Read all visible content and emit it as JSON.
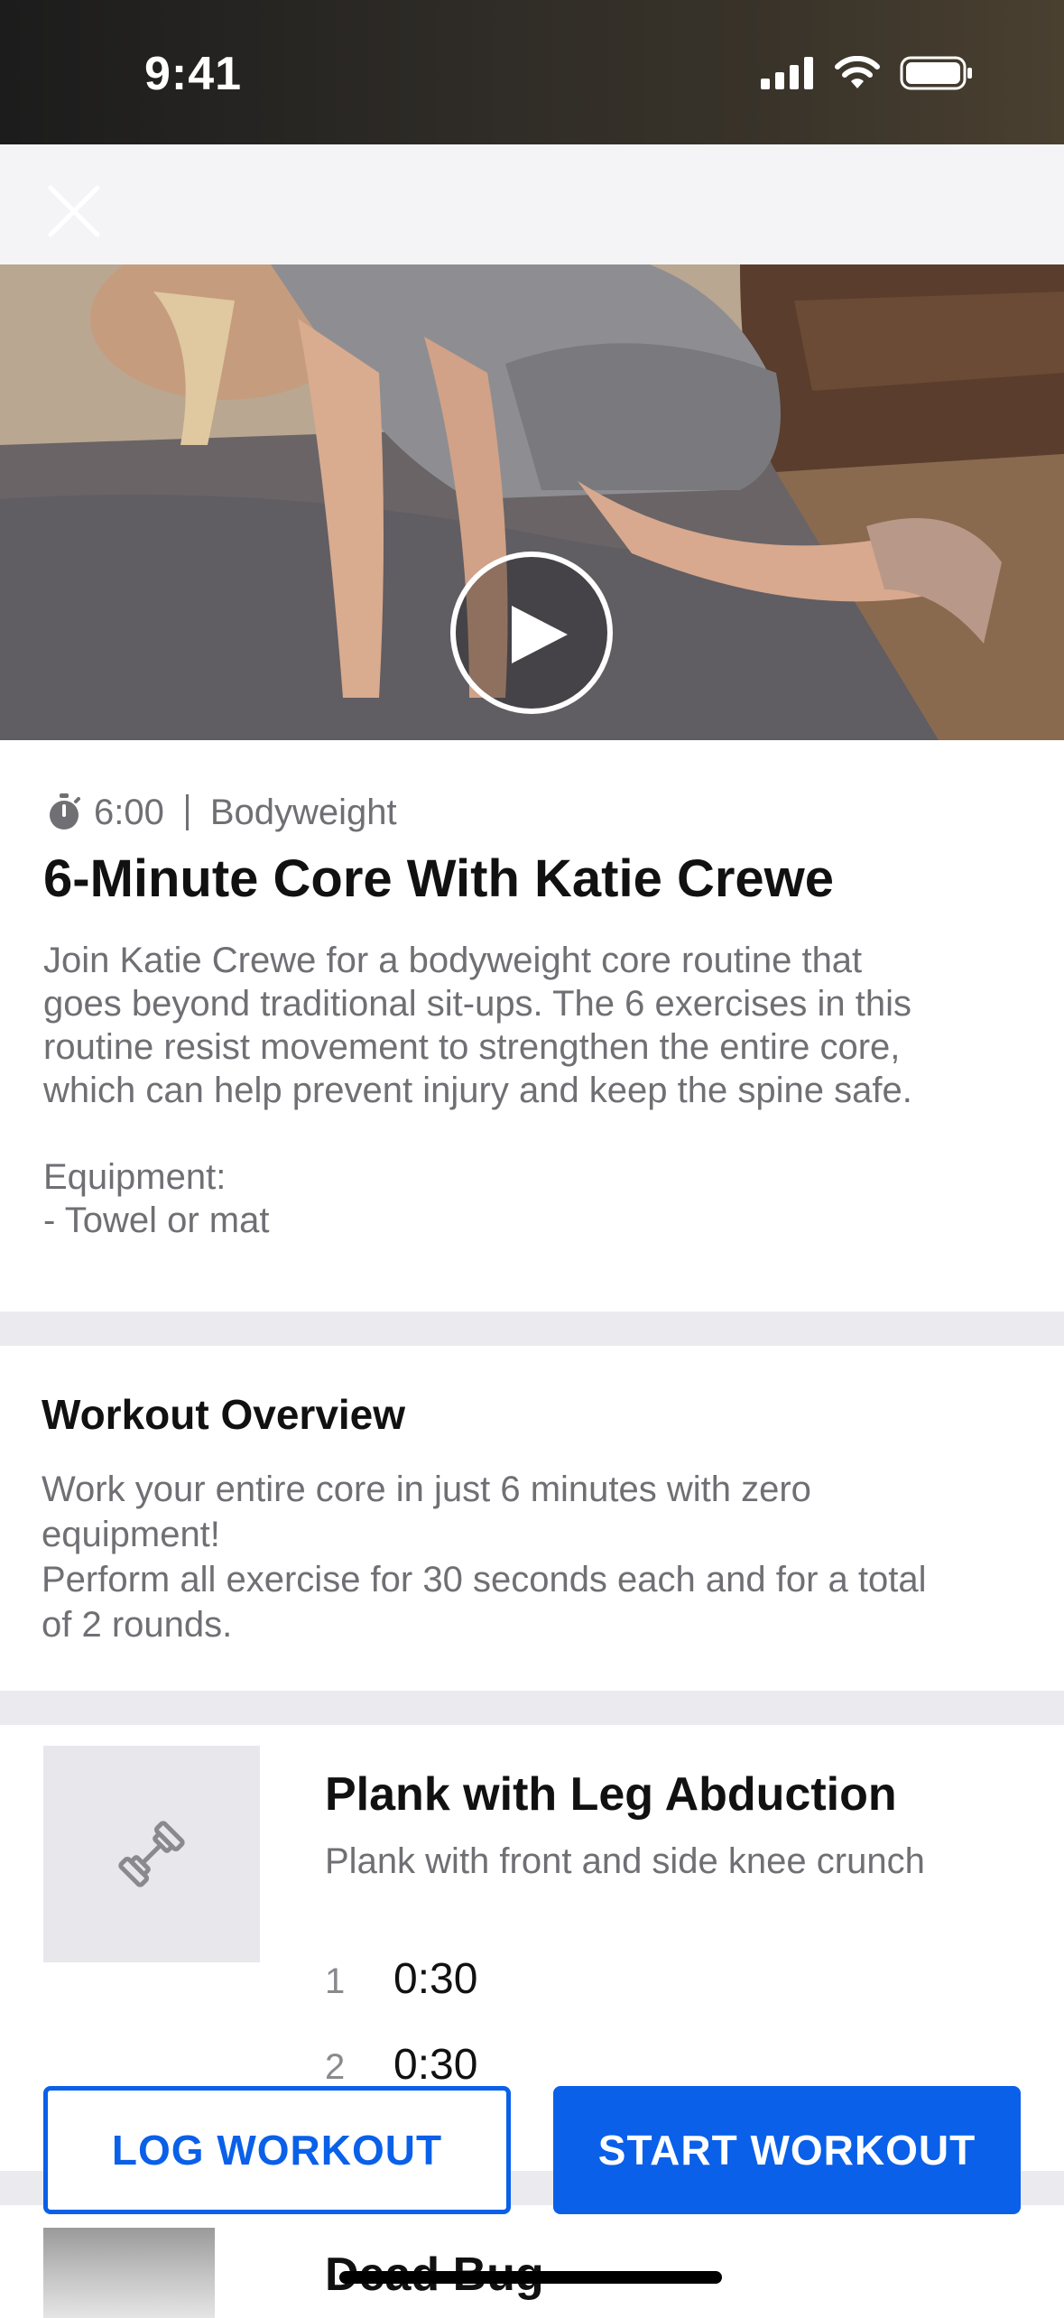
{
  "status_bar": {
    "time": "9:41"
  },
  "workout": {
    "duration": "6:00",
    "category": "Bodyweight",
    "title": "6-Minute Core With Katie Crewe",
    "description": "Join Katie Crewe for a bodyweight core routine that\ngoes beyond traditional sit-ups. The 6 exercises in this\nroutine resist movement to strengthen the entire core,\nwhich can help prevent injury and keep the spine safe.\n\nEquipment:\n- Towel or mat"
  },
  "overview": {
    "title": "Workout Overview",
    "text": "Work your entire core in just 6 minutes with zero\nequipment!\nPerform all exercise for 30 seconds each and for a total\nof 2 rounds."
  },
  "exercises": [
    {
      "name": "Plank with Leg Abduction",
      "subtitle": "Plank with front and side knee crunch",
      "sets": [
        {
          "num": "1",
          "time": "0:30"
        },
        {
          "num": "2",
          "time": "0:30"
        }
      ]
    },
    {
      "name": "Dead Bug"
    }
  ],
  "actions": {
    "log_label": "LOG WORKOUT",
    "start_label": "START WORKOUT"
  },
  "colors": {
    "accent": "#0a60e8",
    "muted_text": "#6f6f74",
    "band": "#ebebef"
  }
}
